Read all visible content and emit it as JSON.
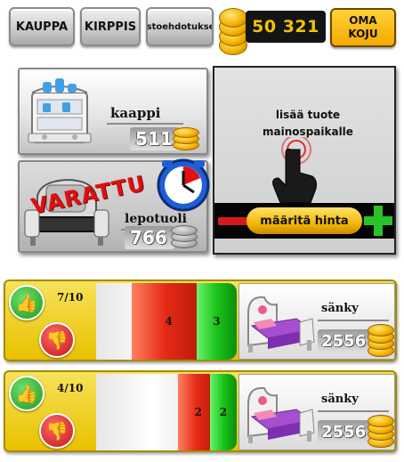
{
  "nav": {
    "kauppa": "KAUPPA",
    "kirppis": "KIRPPIS",
    "ostoehdotukset": "ostoehdotukset",
    "money": "50 321",
    "oma_koju_line1": "OMA",
    "oma_koju_line2": "KOJU"
  },
  "stall": {
    "items": [
      {
        "name": "kaappi",
        "price": "511",
        "sold": false
      },
      {
        "name": "lepotuoli",
        "price": "766",
        "sold": true,
        "stamp": "VARATTU"
      }
    ],
    "empty_slot": {
      "text": "lisää tuote\nmainospaikalle",
      "price_label": "määritä hinta"
    }
  },
  "offers": [
    {
      "votes": "7/10",
      "red_value": "4",
      "green_value": "3",
      "item_name": "sänky",
      "price": "2556",
      "red_fraction": 0.4,
      "green_fraction": 0.3
    },
    {
      "votes": "4/10",
      "red_value": "2",
      "green_value": "2",
      "item_name": "sänky",
      "price": "2556",
      "red_fraction": 0.2,
      "green_fraction": 0.2
    }
  ],
  "colors": {
    "gold": "#f2c400",
    "offer_bg": "#f0cf1a",
    "red": "#e52a16",
    "green": "#19c419"
  },
  "icons": [
    "coin-stack-icon",
    "cabinet-icon",
    "armchair-icon",
    "clock-icon",
    "pointing-hand-icon",
    "thumbs-up-icon",
    "thumbs-down-icon",
    "bed-icon"
  ]
}
